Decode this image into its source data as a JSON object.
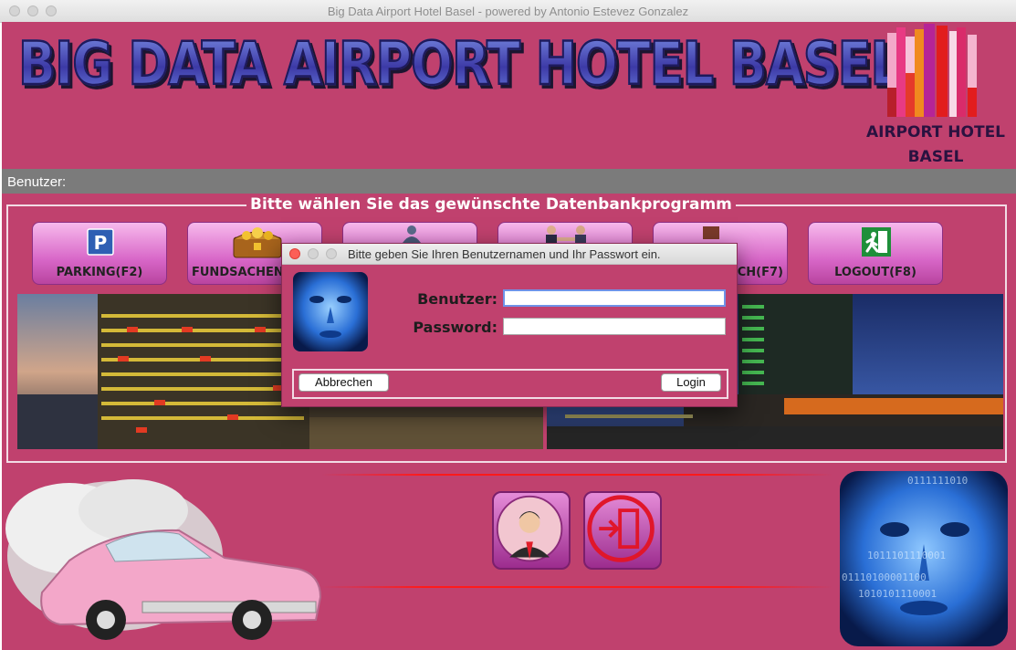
{
  "window": {
    "title": "Big Data Airport Hotel Basel - powered by Antonio Estevez Gonzalez"
  },
  "header": {
    "title": "BIG DATA AIRPORT HOTEL BASEL",
    "logo_line1": "AIRPORT HOTEL",
    "logo_line2": "BASEL"
  },
  "user_bar": {
    "label": "Benutzer:"
  },
  "panel": {
    "title": "Bitte wählen Sie das gewünschte Datenbankprogramm",
    "buttons": [
      {
        "label": "PARKING(F2)",
        "icon": "parking-icon"
      },
      {
        "label": "FUNDSACHEN",
        "icon": "treasure-chest-icon"
      },
      {
        "label": "",
        "icon": "person-icon"
      },
      {
        "label": "",
        "icon": "handshake-icon"
      },
      {
        "label": "CH(F7)",
        "icon": "book-icon"
      },
      {
        "label": "LOGOUT(F8)",
        "icon": "exit-icon"
      }
    ]
  },
  "bottom": {
    "buttons": [
      {
        "icon": "user-avatar-icon"
      },
      {
        "icon": "logout-door-icon"
      }
    ]
  },
  "dialog": {
    "title": "Bitte geben Sie Ihren Benutzernamen und Ihr Passwort ein.",
    "user_label": "Benutzer:",
    "password_label": "Password:",
    "user_value": "",
    "password_value": "",
    "cancel_label": "Abbrechen",
    "login_label": "Login"
  },
  "colors": {
    "background": "#c0416e",
    "user_bar": "#7b7b7b",
    "button_gradient_top": "#f7b9ec",
    "button_gradient_bottom": "#b9449f"
  }
}
